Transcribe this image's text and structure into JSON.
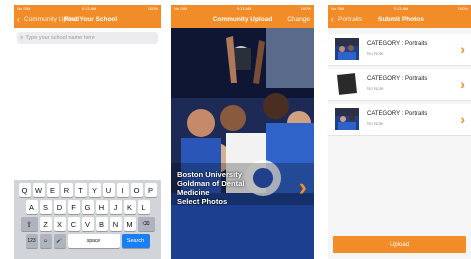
{
  "status": {
    "carrier": "No SIM",
    "time": "9:13 AM",
    "battery": "100%"
  },
  "screen1": {
    "back_label": "Community Upload",
    "title": "Find Your School",
    "search_placeholder": "Type your school name here",
    "keyboard": {
      "row1": [
        "Q",
        "W",
        "E",
        "R",
        "T",
        "Y",
        "U",
        "I",
        "O",
        "P"
      ],
      "row2": [
        "A",
        "S",
        "D",
        "F",
        "G",
        "H",
        "J",
        "K",
        "L"
      ],
      "row3": [
        "Z",
        "X",
        "C",
        "V",
        "B",
        "N",
        "M"
      ],
      "shift": "⇧",
      "delete": "⌫",
      "numbers": "123",
      "emoji": "☺",
      "mic": "🎤",
      "space": "space",
      "action": "Search"
    }
  },
  "screen2": {
    "title": "Community Upload",
    "right_action": "Change",
    "caption_line1": "Boston University",
    "caption_line2": "Goldman of Dental",
    "caption_line3": "Medicine",
    "caption_line4": "Select Photos"
  },
  "screen3": {
    "back_label": "Portraits",
    "title": "Submit Photos",
    "items": [
      {
        "category": "CATEGORY : Portraits",
        "note": "No Note"
      },
      {
        "category": "CATEGORY : Portraits",
        "note": "No Note"
      },
      {
        "category": "CATEGORY : Portraits",
        "note": "No Note"
      }
    ],
    "upload_label": "Upload"
  },
  "colors": {
    "accent": "#f28c28",
    "keyboard_bg": "#d1d4d9",
    "search_key": "#1a7ef5"
  }
}
